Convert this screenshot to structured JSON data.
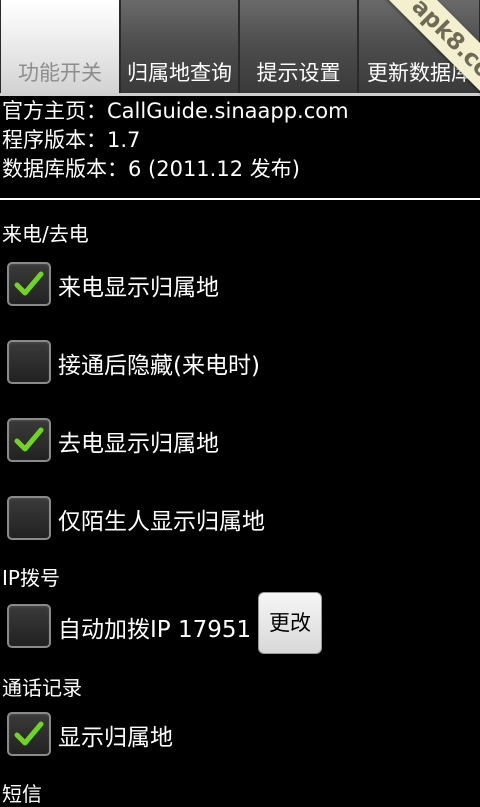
{
  "tabs": [
    {
      "label": "功能开关",
      "active": true
    },
    {
      "label": "归属地查询",
      "active": false
    },
    {
      "label": "提示设置",
      "active": false
    },
    {
      "label": "更新数据库",
      "active": false
    }
  ],
  "watermark": "apk8.com",
  "info": {
    "homepage": "官方主页：CallGuide.sinaapp.com",
    "version": "程序版本：1.7",
    "db_version": "数据库版本：6 (2011.12  发布)"
  },
  "sections": {
    "call": "来电/去电",
    "ip": "IP拨号",
    "log": "通话记录",
    "sms": "短信"
  },
  "options": {
    "incoming_show": {
      "label": "来电显示归属地",
      "checked": true
    },
    "hide_after_answer": {
      "label": "接通后隐藏(来电时)",
      "checked": false
    },
    "outgoing_show": {
      "label": "去电显示归属地",
      "checked": true
    },
    "stranger_only": {
      "label": "仅陌生人显示归属地",
      "checked": false
    },
    "auto_ip": {
      "label": "自动加拨IP  17951",
      "checked": false
    },
    "log_show": {
      "label": "显示归属地",
      "checked": true
    }
  },
  "buttons": {
    "change": "更改"
  },
  "colors": {
    "check": "#6fd61f",
    "accent": "#ffffff"
  }
}
